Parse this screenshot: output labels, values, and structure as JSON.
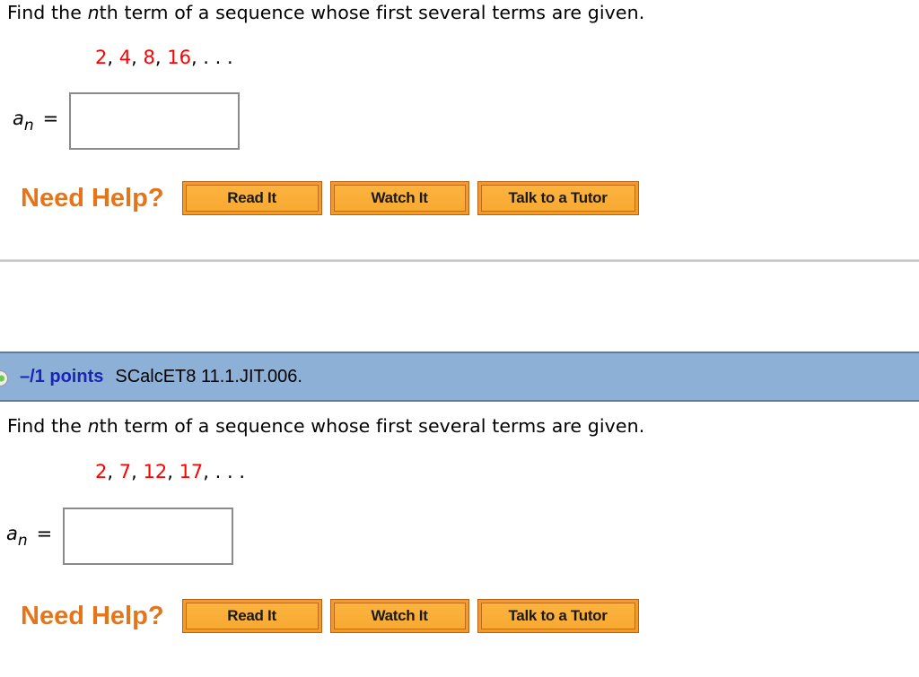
{
  "questions": [
    {
      "prompt_before": "Find the ",
      "prompt_italic": "n",
      "prompt_after": "th term of a sequence whose first several terms are given.",
      "terms": [
        "2",
        "4",
        "8",
        "16"
      ],
      "ellipsis": ". . .",
      "answer_label_var": "a",
      "answer_label_sub": "n",
      "answer_label_eq": "=",
      "answer_value": "",
      "help": {
        "label": "Need Help?",
        "buttons": [
          "Read It",
          "Watch It",
          "Talk to a Tutor"
        ]
      }
    },
    {
      "header": {
        "points": "–/1 points",
        "question_id": "SCalcET8 11.1.JIT.006."
      },
      "prompt_before": "Find the ",
      "prompt_italic": "n",
      "prompt_after": "th term of a sequence whose first several terms are given.",
      "terms": [
        "2",
        "7",
        "12",
        "17"
      ],
      "ellipsis": ". . .",
      "answer_label_var": "a",
      "answer_label_sub": "n",
      "answer_label_eq": "=",
      "answer_value": "",
      "help": {
        "label": "Need Help?",
        "buttons": [
          "Read It",
          "Watch It",
          "Talk to a Tutor"
        ]
      }
    }
  ],
  "colors": {
    "term": "#ff0000",
    "need_help": "#e67519",
    "button_fill": "#f8a932",
    "header_bg": "#8db1d6",
    "points": "#1b24b5"
  }
}
